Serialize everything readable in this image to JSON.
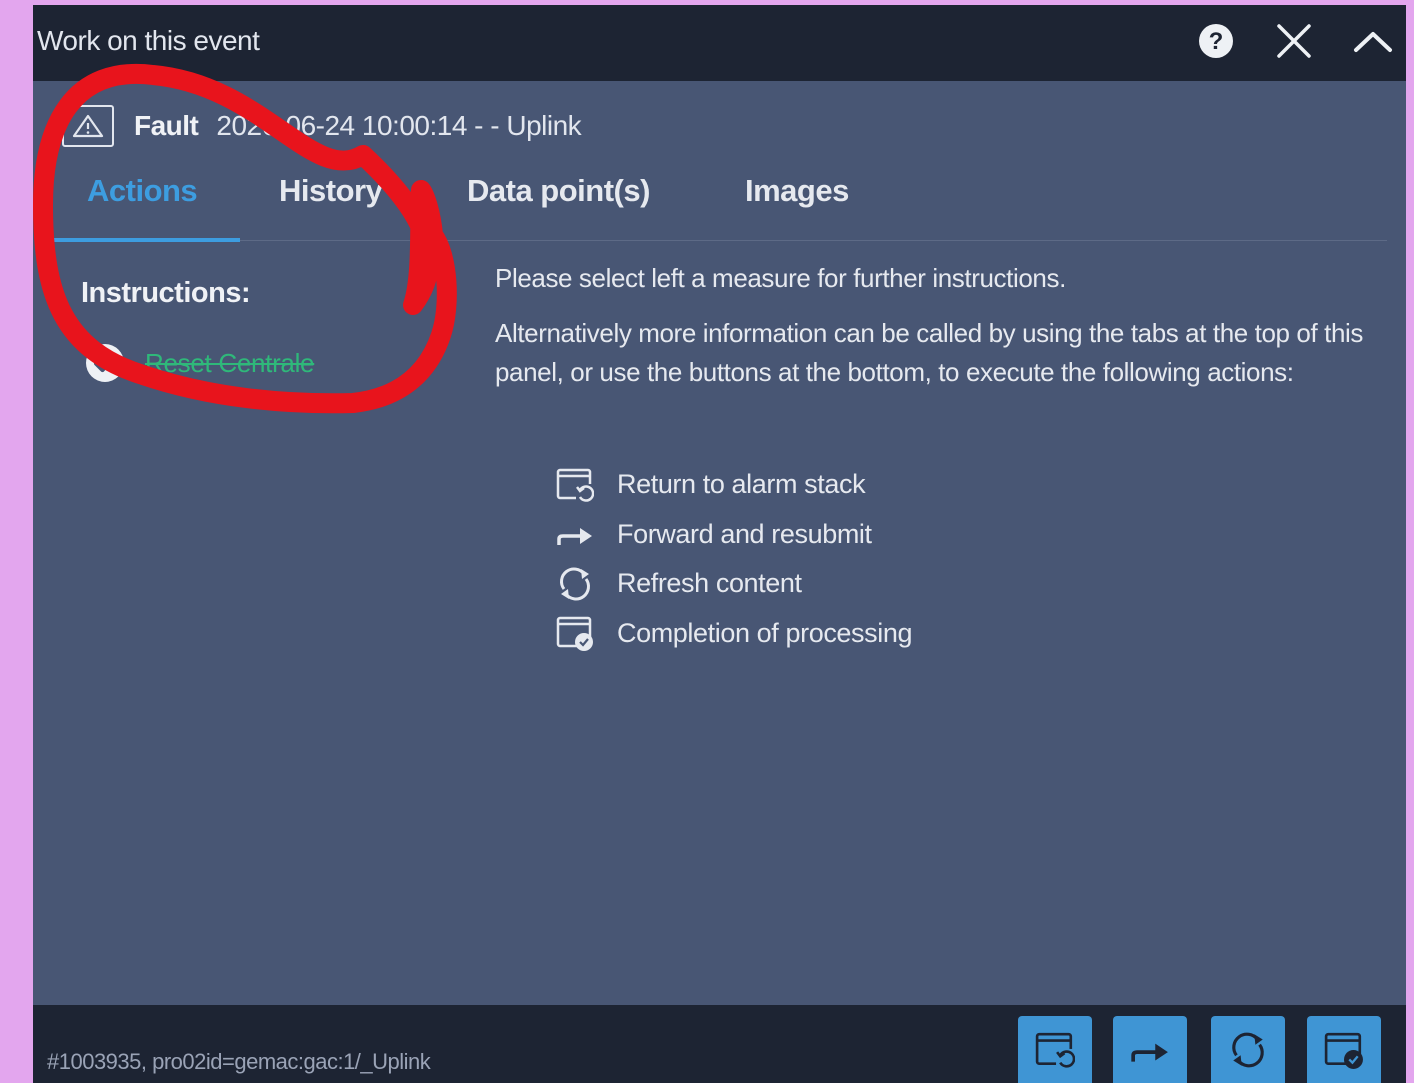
{
  "window": {
    "title": "Work on this event",
    "buttons": [
      "help-icon",
      "close-icon",
      "collapse-icon"
    ]
  },
  "event": {
    "type": "Fault",
    "description": "2026-06-24 10:00:14 - - Uplink",
    "icon": "warning-triangle-icon"
  },
  "tabs": [
    {
      "label": "Actions",
      "active": true
    },
    {
      "label": "History",
      "active": false
    },
    {
      "label": "Data point(s)",
      "active": false
    },
    {
      "label": "Images",
      "active": false
    }
  ],
  "instructions": {
    "title": "Instructions:",
    "items": [
      {
        "label": "Reset Centrale",
        "done": true,
        "icon": "check-circle-icon"
      }
    ]
  },
  "info": {
    "paragraph1": "Please select left a measure for further instructions.",
    "paragraph2": "Alternatively more information can be called by using the tabs at the top of this panel, or use the buttons at the bottom, to execute the following actions:"
  },
  "actions": [
    {
      "label": "Return to alarm stack",
      "icon": "return-stack-icon"
    },
    {
      "label": "Forward and resubmit",
      "icon": "forward-arrow-icon"
    },
    {
      "label": "Refresh content",
      "icon": "refresh-icon"
    },
    {
      "label": "Completion of processing",
      "icon": "complete-check-icon"
    }
  ],
  "footer": {
    "id_text": "#1003935, pro02id=gemac:gac:1/_Uplink"
  },
  "colors": {
    "background": "#e3a6ee",
    "panel": "#485674",
    "titlebar": "#1d2433",
    "accent": "#3d9de0",
    "done_green": "#2fb87a",
    "annotation_red": "#e8141c"
  }
}
